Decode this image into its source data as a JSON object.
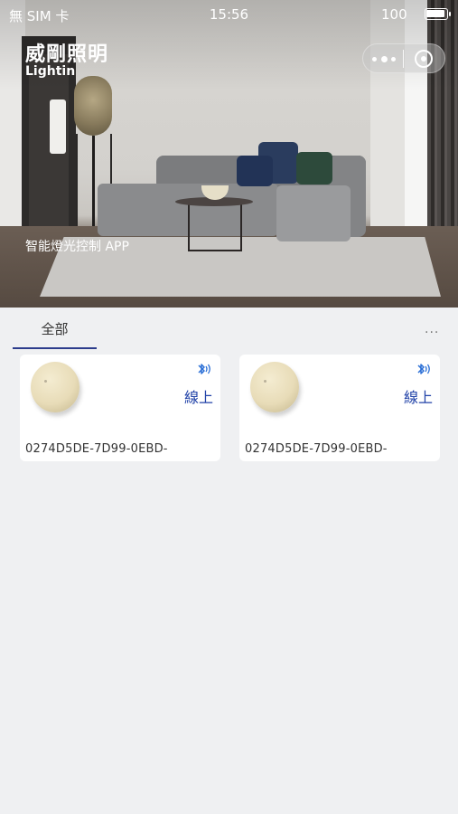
{
  "status_bar": {
    "carrier": "無 SIM 卡",
    "time": "15:56",
    "battery": "100"
  },
  "header": {
    "title": "威剛照明",
    "subtitle": "Lightin"
  },
  "hero": {
    "caption": "智能燈光控制 APP"
  },
  "tabs": [
    {
      "label": "全部",
      "active": true
    }
  ],
  "more_label": "...",
  "devices": [
    {
      "status": "線上",
      "id": "0274D5DE-7D99-0EBD-",
      "icon": "bluetooth-icon"
    },
    {
      "status": "線上",
      "id": "0274D5DE-7D99-0EBD-",
      "icon": "bluetooth-icon"
    }
  ],
  "colors": {
    "accent": "#2243a8",
    "tab_underline": "#2c3c8c",
    "background": "#eff0f2"
  }
}
